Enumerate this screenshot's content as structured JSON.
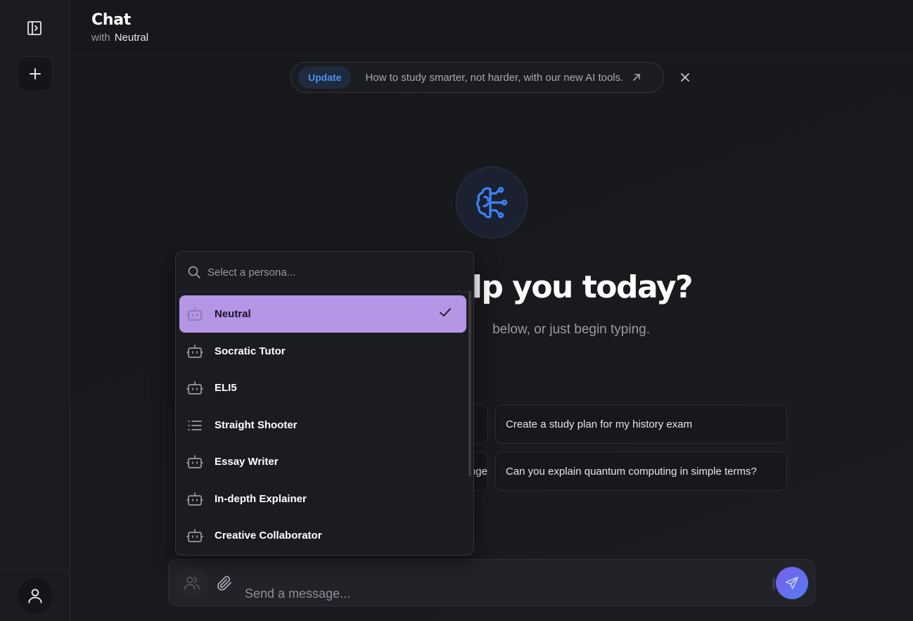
{
  "header": {
    "title": "Chat",
    "with_label": "with",
    "persona": "Neutral"
  },
  "banner": {
    "badge": "Update",
    "text": "How to study smarter, not harder, with our new AI tools."
  },
  "hero": {
    "title_visible": "elp you today?",
    "subtitle_visible": "below, or just begin typing."
  },
  "suggestions": {
    "left_top": "",
    "left_bottom": "nge",
    "right_top": "Create a study plan for my history exam",
    "right_bottom": "Can you explain quantum computing in simple terms?"
  },
  "composer": {
    "placeholder": "Send a message..."
  },
  "persona_menu": {
    "search_placeholder": "Select a persona...",
    "items": [
      {
        "label": "Neutral",
        "icon": "bot-icon",
        "selected": true
      },
      {
        "label": "Socratic Tutor",
        "icon": "bot-icon",
        "selected": false
      },
      {
        "label": "ELI5",
        "icon": "bot-icon",
        "selected": false
      },
      {
        "label": "Straight Shooter",
        "icon": "list-icon",
        "selected": false
      },
      {
        "label": "Essay Writer",
        "icon": "bot-icon",
        "selected": false
      },
      {
        "label": "In-depth Explainer",
        "icon": "bot-icon",
        "selected": false
      },
      {
        "label": "Creative Collaborator",
        "icon": "bot-icon",
        "selected": false
      }
    ]
  },
  "colors": {
    "accent_selected": "#b495e6",
    "badge_blue": "#4c8ff0",
    "hero_icon_blue": "#3b82f6"
  }
}
